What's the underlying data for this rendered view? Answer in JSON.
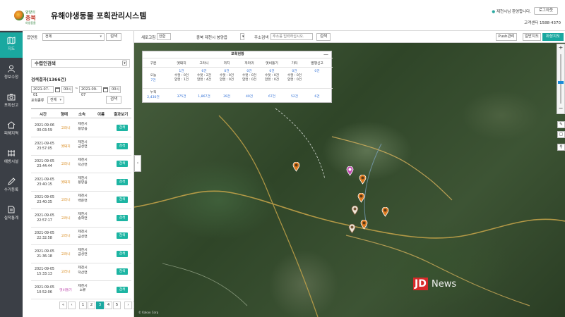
{
  "header": {
    "logo_small": "양양의",
    "logo_main": "충북",
    "logo_sub": "야생동물",
    "title": "유해야생동물 포획관리시스템",
    "welcome": "제천시님 환영합니다.",
    "logout_label": "로그아웃",
    "call_center": "고객센터 1588-4370"
  },
  "sidenav": {
    "items": [
      {
        "label": "지도",
        "icon": "map-icon"
      },
      {
        "label": "정보수정",
        "icon": "user-icon"
      },
      {
        "label": "포획신고",
        "icon": "camera-icon"
      },
      {
        "label": "피해지역",
        "icon": "home-icon"
      },
      {
        "label": "예방시설",
        "icon": "fence-icon"
      },
      {
        "label": "수거등록",
        "icon": "pen-icon"
      },
      {
        "label": "실적통계",
        "icon": "document-icon"
      }
    ]
  },
  "panel": {
    "region_label": "읍면동",
    "region_value": "전체",
    "search_button": "검색",
    "section_title": "수렵인검색",
    "result_count": "검색결과(1366건)",
    "date_from": "2021-07-01",
    "hour_from": "00시",
    "date_sep": "~",
    "date_to": "2021-09-07",
    "hour_to": "00시",
    "type_label": "포획종류",
    "type_value": "전체",
    "search_button2": "검색",
    "columns": [
      "시간",
      "형태",
      "소속",
      "이름",
      "결과보기"
    ],
    "rows": [
      {
        "date": "2021-09-06",
        "time": "00:03:59",
        "kind": "고라니",
        "loc1": "제천시",
        "loc2": "봉양읍",
        "badge": "검색",
        "kind_color": "#d98b1e"
      },
      {
        "date": "2021-09-05",
        "time": "23:57:05",
        "kind": "멧돼지",
        "loc1": "제천시",
        "loc2": "금성면",
        "badge": "검색",
        "kind_color": "#d98b1e"
      },
      {
        "date": "2021-09-05",
        "time": "23:44:44",
        "kind": "고라니",
        "loc1": "제천시",
        "loc2": "덕산면",
        "badge": "검색",
        "kind_color": "#d98b1e"
      },
      {
        "date": "2021-09-05",
        "time": "23:40:15",
        "kind": "멧돼지",
        "loc1": "제천시",
        "loc2": "봉양읍",
        "badge": "검색",
        "kind_color": "#d98b1e"
      },
      {
        "date": "2021-09-05",
        "time": "23:40:35",
        "kind": "고라니",
        "loc1": "제천시",
        "loc2": "백운면",
        "badge": "검색",
        "kind_color": "#d98b1e"
      },
      {
        "date": "2021-09-05",
        "time": "22:57:17",
        "kind": "고라니",
        "loc1": "제천시",
        "loc2": "송학면",
        "badge": "검색",
        "kind_color": "#d98b1e"
      },
      {
        "date": "2021-09-05",
        "time": "22:32:58",
        "kind": "고라니",
        "loc1": "제천시",
        "loc2": "금성면",
        "badge": "검색",
        "kind_color": "#d98b1e"
      },
      {
        "date": "2021-09-05",
        "time": "21:36:18",
        "kind": "고라니",
        "loc1": "제천시",
        "loc2": "금성면",
        "badge": "검색",
        "kind_color": "#d98b1e"
      },
      {
        "date": "2021-09-05",
        "time": "15:33:13",
        "kind": "고라니",
        "loc1": "제천시",
        "loc2": "덕산면",
        "badge": "검색",
        "kind_color": "#d98b1e"
      },
      {
        "date": "2021-09-05",
        "time": "10:52:06",
        "kind": "멧비둘기",
        "loc1": "제천시",
        "loc2": "소류",
        "badge": "검색",
        "kind_color": "#c04fb0"
      }
    ],
    "pager": [
      "«",
      "‹",
      "1",
      "2",
      "3",
      "4",
      "5",
      "›",
      "»"
    ],
    "current_page": "3"
  },
  "map_toolbar": {
    "layer_label": "새로고침",
    "layer_value": "안함",
    "filter_label": "충북 제천시 봉양읍",
    "address_label": "주소검색",
    "address_placeholder": "주소를 입력하십시오.",
    "search_button": "검색",
    "push_button": "Push관리",
    "normal_map": "일반지도",
    "satellite_map": "위성지도"
  },
  "overlay": {
    "title": "포획현황",
    "minimize": "—",
    "headers": [
      "구분",
      "멧돼지",
      "고라니",
      "까치",
      "까마귀",
      "멧비둘기",
      "기타",
      "멸행신고"
    ],
    "today_label": "오늘",
    "today_total": "7건",
    "today": [
      {
        "count": "1건",
        "a": "수컷 : 0건",
        "b": "암컷 : 1건"
      },
      {
        "count": "6건",
        "a": "수컷 : 2건",
        "b": "암컷 : 4건"
      },
      {
        "count": "0건",
        "a": "수컷 : 0건",
        "b": "암컷 : 0건"
      },
      {
        "count": "0건",
        "a": "수컷 : 0건",
        "b": "암컷 : 0건"
      },
      {
        "count": "0건",
        "a": "수컷 : 0건",
        "b": "암컷 : 0건"
      },
      {
        "count": "0건",
        "a": "수컷 : 0건",
        "b": "암컷 : 0건"
      },
      {
        "count": "0건",
        "a": "",
        "b": ""
      }
    ],
    "cum_label": "누적",
    "cum_total": "2,430건",
    "cumulative": [
      "375건",
      "1,867건",
      "39건",
      "40건",
      "67건",
      "52건",
      "6건"
    ]
  },
  "map": {
    "zoom_in": "+",
    "zoom_out": "−",
    "attribution": "© Kakao Corp",
    "watermark_a": "JD",
    "watermark_b": "News",
    "marker_color": "#e07b1f",
    "accent": "#1aa8a0"
  }
}
